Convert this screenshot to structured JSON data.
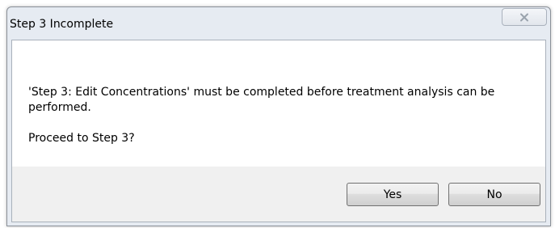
{
  "window": {
    "title": "Step 3 Incomplete",
    "close_icon": "close-x-icon"
  },
  "body": {
    "message": "'Step 3: Edit Concentrations' must be completed before treatment analysis can be performed.",
    "question": "Proceed to Step 3?"
  },
  "buttons": {
    "yes_label": "Yes",
    "no_label": "No"
  }
}
